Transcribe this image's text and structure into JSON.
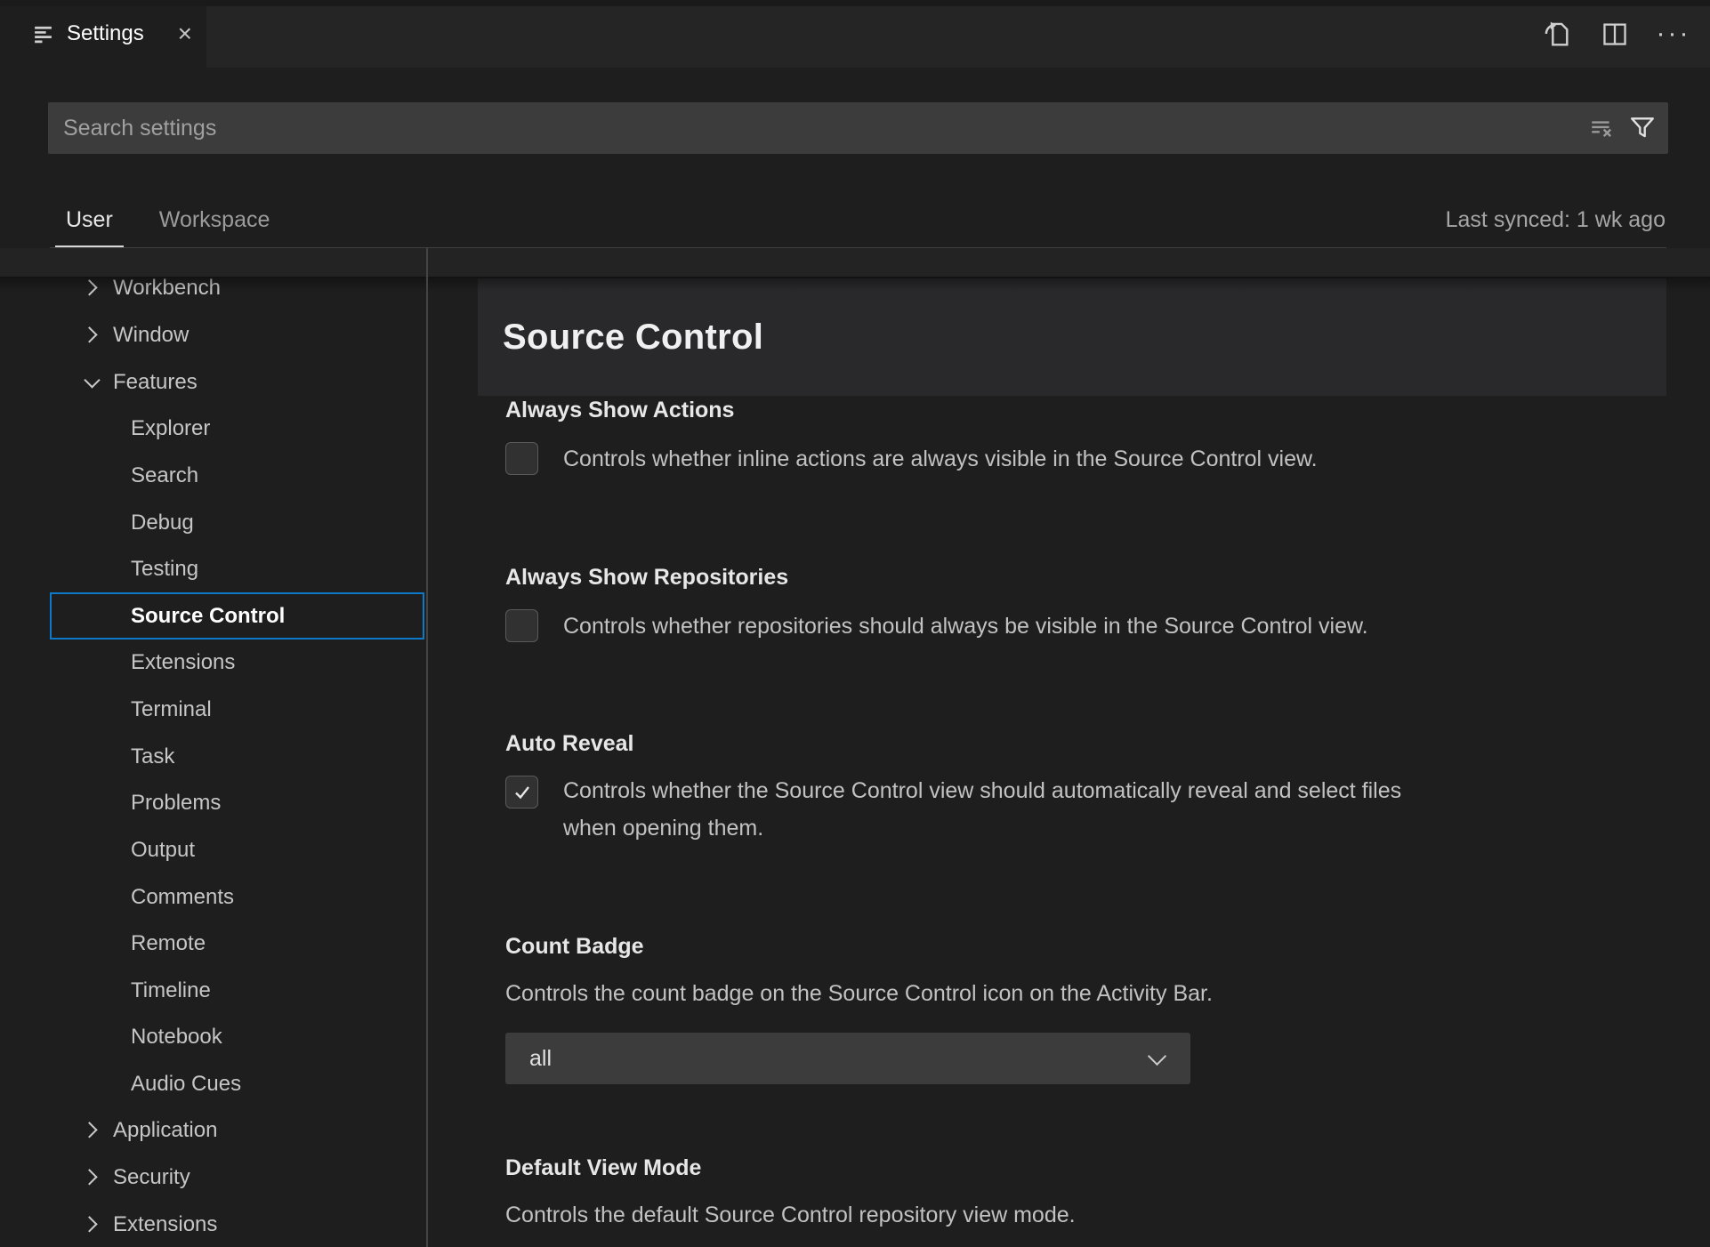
{
  "tab": {
    "label": "Settings",
    "close_glyph": "×"
  },
  "editor_actions": {
    "more_glyph": "···"
  },
  "search": {
    "placeholder": "Search settings",
    "value": ""
  },
  "header": {
    "modes": [
      {
        "label": "User",
        "active": true
      },
      {
        "label": "Workspace",
        "active": false
      }
    ],
    "last_synced": "Last synced: 1 wk ago"
  },
  "toc": {
    "items": [
      {
        "label": "Workbench",
        "level": 1,
        "chevron": "right",
        "selected": false
      },
      {
        "label": "Window",
        "level": 1,
        "chevron": "right",
        "selected": false
      },
      {
        "label": "Features",
        "level": 1,
        "chevron": "down",
        "selected": false
      },
      {
        "label": "Explorer",
        "level": 2,
        "chevron": "none",
        "selected": false
      },
      {
        "label": "Search",
        "level": 2,
        "chevron": "none",
        "selected": false
      },
      {
        "label": "Debug",
        "level": 2,
        "chevron": "none",
        "selected": false
      },
      {
        "label": "Testing",
        "level": 2,
        "chevron": "none",
        "selected": false
      },
      {
        "label": "Source Control",
        "level": 2,
        "chevron": "none",
        "selected": true
      },
      {
        "label": "Extensions",
        "level": 2,
        "chevron": "none",
        "selected": false
      },
      {
        "label": "Terminal",
        "level": 2,
        "chevron": "none",
        "selected": false
      },
      {
        "label": "Task",
        "level": 2,
        "chevron": "none",
        "selected": false
      },
      {
        "label": "Problems",
        "level": 2,
        "chevron": "none",
        "selected": false
      },
      {
        "label": "Output",
        "level": 2,
        "chevron": "none",
        "selected": false
      },
      {
        "label": "Comments",
        "level": 2,
        "chevron": "none",
        "selected": false
      },
      {
        "label": "Remote",
        "level": 2,
        "chevron": "none",
        "selected": false
      },
      {
        "label": "Timeline",
        "level": 2,
        "chevron": "none",
        "selected": false
      },
      {
        "label": "Notebook",
        "level": 2,
        "chevron": "none",
        "selected": false
      },
      {
        "label": "Audio Cues",
        "level": 2,
        "chevron": "none",
        "selected": false
      },
      {
        "label": "Application",
        "level": 1,
        "chevron": "right",
        "selected": false
      },
      {
        "label": "Security",
        "level": 1,
        "chevron": "right",
        "selected": false
      },
      {
        "label": "Extensions",
        "level": 1,
        "chevron": "right",
        "selected": false
      }
    ]
  },
  "settings": {
    "title": "Source Control",
    "items": [
      {
        "label": "Always Show Actions",
        "type": "checkbox",
        "checked": false,
        "description": "Controls whether inline actions are always visible in the Source Control view."
      },
      {
        "label": "Always Show Repositories",
        "type": "checkbox",
        "checked": false,
        "description": "Controls whether repositories should always be visible in the Source Control view."
      },
      {
        "label": "Auto Reveal",
        "type": "checkbox",
        "checked": true,
        "description": "Controls whether the Source Control view should automatically reveal and select files when opening them."
      },
      {
        "label": "Count Badge",
        "type": "select",
        "value": "all",
        "description": "Controls the count badge on the Source Control icon on the Activity Bar."
      },
      {
        "label": "Default View Mode",
        "type": "label-only",
        "description": "Controls the default Source Control repository view mode."
      }
    ]
  }
}
